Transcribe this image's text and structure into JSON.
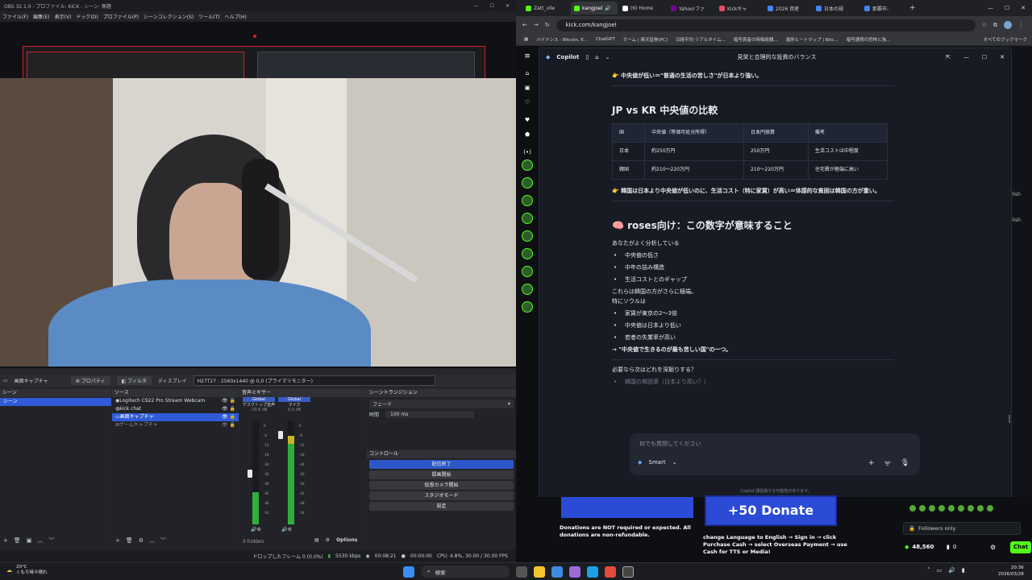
{
  "obs": {
    "title": "OBS 32.1.0 - プロファイル: KICK - シーン: 無題",
    "menu": [
      "ファイル(F)",
      "編集(E)",
      "表示(V)",
      "ドック(D)",
      "プロファイル(P)",
      "シーンコレクション(S)",
      "ツール(T)",
      "ヘルプ(H)"
    ],
    "source_toolbar": {
      "source_name": "画面キャプチャ",
      "properties": "プロパティ",
      "filters": "フィルタ",
      "display_label": "ディスプレイ",
      "display_value": "H27T27 : 2560x1440 @ 0,0 (プライマリモニター)"
    },
    "scenes": {
      "header": "シーン",
      "items": [
        "シーン"
      ]
    },
    "sources": {
      "header": "ソース",
      "items": [
        "Logitech C922 Pro Stream Webcam",
        "kick chat",
        "画面キャプチャ",
        "ゲームキャプチャ"
      ],
      "selected": 2
    },
    "mixer": {
      "header": "音声ミキサー",
      "channels": [
        {
          "badge": "Global",
          "name": "デスクトップ音声",
          "db": "-20.8 dB",
          "level": 0.55
        },
        {
          "badge": "Global",
          "name": "マイク",
          "db": "0.0 dB",
          "level": 0.9
        }
      ],
      "scale": [
        "0",
        "-6",
        "-12",
        "-18",
        "-24",
        "-30",
        "-36",
        "-42",
        "-48",
        "-54",
        "-60"
      ],
      "hidden_label": "0 hidden"
    },
    "transitions": {
      "header": "シーントランジション",
      "type": "フェード",
      "duration_label": "時間",
      "duration_value": "100 ms"
    },
    "controls": {
      "header": "コントロール",
      "buttons": [
        "配信終了",
        "録画開始",
        "仮想カメラ開始",
        "スタジオモード",
        "設定"
      ]
    },
    "options_label": "Options",
    "status": {
      "dropped": "ドロップしたフレーム 0 (0.0%)",
      "bitrate": "5530 kbps",
      "time": "00:08:21",
      "time2": "00:00:00",
      "cpu": "CPU: 4.8%, 30.00 / 30.00 FPS"
    }
  },
  "browser": {
    "tabs": [
      {
        "label": "Zatt_vile",
        "color": "#53fc18"
      },
      {
        "label": "kangjoel",
        "color": "#53fc18"
      },
      {
        "label": "(6) Home",
        "color": "#ffffff"
      },
      {
        "label": "Yahoo!ファ",
        "color": "#7b0099"
      },
      {
        "label": "Kickギャ",
        "color": "#e84a6b"
      },
      {
        "label": "2026 資産",
        "color": "#4285f4"
      },
      {
        "label": "日本の規",
        "color": "#4285f4"
      },
      {
        "label": "那覇市、",
        "color": "#4285f4"
      }
    ],
    "url": "kick.com/kangjoel",
    "bookmarks": [
      "バイナンス - Bitcoin, E...",
      "ChatGPT",
      "ホーム | 楽天証券[PC]",
      "日経平均 リアルタイム...",
      "暗号資産の時価総額...",
      "進捗ヒートマップ | Bitc...",
      "暗号通貨の恐怖と強...",
      "すべてのブックマーク"
    ]
  },
  "copilot": {
    "app_name": "Copilot",
    "window_title": "見栄と合理的な投資のバランス",
    "line1": "👉 中央値が低い＝\"普通の生活の苦しさ\"が日本より強い。",
    "h_compare": "JP vs KR 中央値の比較",
    "table": {
      "headers": [
        "国",
        "中央値（等価可処分所得）",
        "日本円換算",
        "備考"
      ],
      "rows": [
        [
          "日本",
          "約250万円",
          "250万円",
          "生活コストは中程度"
        ],
        [
          "韓国",
          "約210〜220万円",
          "210〜220万円",
          "住宅費が極端に高い"
        ]
      ]
    },
    "line2": "👉 韓国は日本より中央値が低いのに、生活コスト（特に家賃）が高い＝体感的な貧困は韓国の方が重い。",
    "h_roses": "🧠 roses向け：この数字が意味すること",
    "p1": "あなたがよく分析している",
    "bullets1": [
      "中央値の低さ",
      "中年の詰み構造",
      "生活コストとのギャップ"
    ],
    "p2": "これらは韓国の方がさらに極端。",
    "p3": "特にソウルは",
    "bullets2": [
      "家賃が東京の2〜3倍",
      "中央値は日本より低い",
      "若者の失業率が高い"
    ],
    "p4": "→ \"中央値で生きるのが最も苦しい国\"の一つ。",
    "q": "必要なら次はどれを深掘りする？",
    "q_item": "韓国の貧困率（日本より高い？）",
    "input_placeholder": "何でも質問してください",
    "mode": "Smart",
    "disclaimer": "Copilot 誤認識する可能性があります。"
  },
  "kick": {
    "donate_text": "+50 Donate",
    "donations_note": "Donations are NOT required or expected. All donations are non-refundable.",
    "instructions": "change Language to English → Sign in → click Purchase Cash → select Overseas Payment → use Cash for TTS or Media!",
    "followers_only": "Followers only",
    "points": "48,560",
    "zero": "0",
    "chat_button": "Chat",
    "side_text": "llish"
  },
  "taskbar": {
    "weather_temp": "20°C",
    "weather_desc": "くもり時々晴れ",
    "search": "検索",
    "time": "20:36",
    "date": "2026/03/28"
  }
}
